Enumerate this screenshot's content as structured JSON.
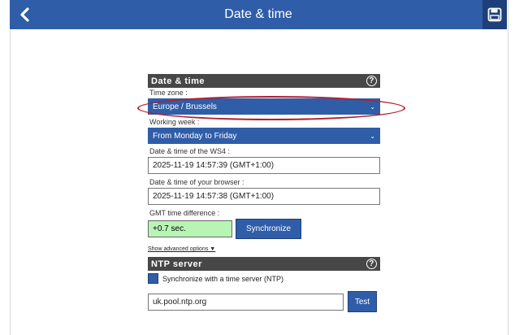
{
  "header": {
    "title": "Date & time",
    "back_icon": "chevron-left-icon",
    "save_icon": "floppy-disk-icon"
  },
  "date_time_section": {
    "title": "Date & time",
    "help": "?",
    "time_zone_label": "Time zone :",
    "time_zone_value": "Europe / Brussels",
    "working_week_label": "Working week :",
    "working_week_value": "From Monday to Friday",
    "ws4_label": "Date & time of the WS4 :",
    "ws4_value": "2025-11-19 14:57:39 (GMT+1:00)",
    "browser_label": "Date & time of your browser :",
    "browser_value": "2025-11-19 14:57:38 (GMT+1:00)",
    "gmt_label": "GMT time difference :",
    "gmt_value": "+0.7 sec.",
    "sync_button": "Synchronize",
    "advanced_link": "Show advanced options ▼"
  },
  "ntp_section": {
    "title": "NTP server",
    "help": "?",
    "checkbox_label": "Synchronize with a time server (NTP)",
    "server_value": "uk.pool.ntp.org",
    "test_button": "Test"
  },
  "colors": {
    "primary": "#2f5da8",
    "section_header": "#474747",
    "highlight": "#b3202d",
    "diff_bg": "#b8f5b5"
  }
}
